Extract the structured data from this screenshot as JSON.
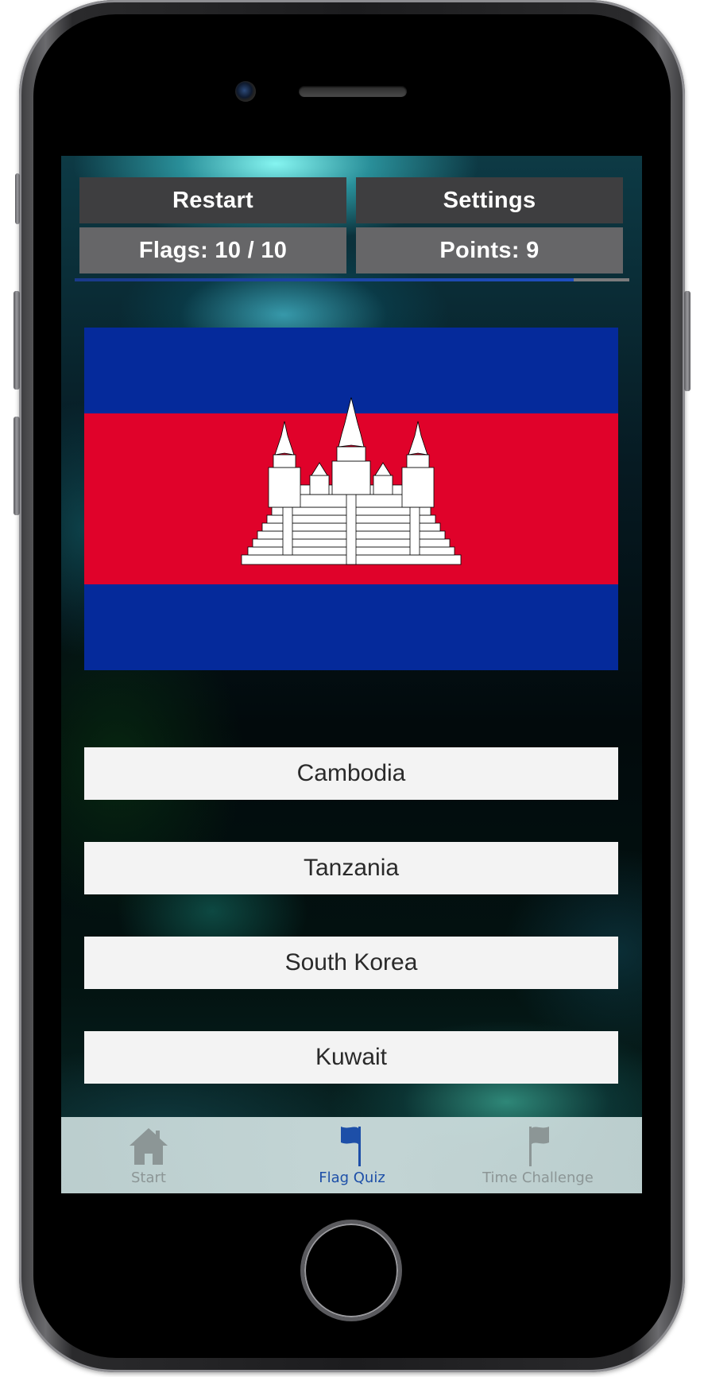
{
  "header": {
    "restart_label": "Restart",
    "settings_label": "Settings",
    "flags_label": "Flags: 10 / 10",
    "points_label": "Points: 9"
  },
  "progress": {
    "fraction": 0.9
  },
  "flag": {
    "country": "Cambodia",
    "colors": {
      "blue": "#052a9b",
      "red": "#e0022a",
      "temple": "#ffffff"
    }
  },
  "answers": [
    {
      "label": "Cambodia"
    },
    {
      "label": "Tanzania"
    },
    {
      "label": "South Korea"
    },
    {
      "label": "Kuwait"
    }
  ],
  "tabbar": {
    "active_color": "#1d4fa8",
    "inactive_color": "#8c9696",
    "items": [
      {
        "label": "Start",
        "icon": "house-icon",
        "active": false
      },
      {
        "label": "Flag Quiz",
        "icon": "flag-icon",
        "active": true
      },
      {
        "label": "Time Challenge",
        "icon": "flag-icon",
        "active": false
      }
    ]
  }
}
